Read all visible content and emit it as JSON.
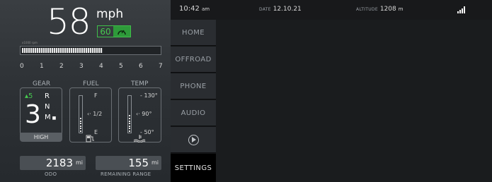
{
  "speed": {
    "value": "58",
    "unit": "mph",
    "limit": "60",
    "cruise_icon": "cruise-control-icon"
  },
  "rpm": {
    "label": "x1000 rpm",
    "ticks": [
      "0",
      "1",
      "2",
      "3",
      "4",
      "5",
      "6",
      "7"
    ],
    "fill_fraction": 0.58
  },
  "gear": {
    "label": "GEAR",
    "current": "3",
    "shift_up": "5",
    "modes": [
      "R",
      "N",
      "M"
    ],
    "mode_label": "HIGH"
  },
  "fuel": {
    "label": "FUEL",
    "full": "F",
    "half": "1/2",
    "empty": "E",
    "level_fraction": 0.4,
    "icon": "fuel-pump-icon"
  },
  "temp": {
    "label": "TEMP",
    "high": "130°",
    "mid": "90°",
    "low": "50°",
    "level_fraction": 0.5,
    "icon": "coolant-temp-icon"
  },
  "odo": {
    "value": "2183",
    "unit": "mi",
    "label": "ODO"
  },
  "range": {
    "value": "155",
    "unit": "mi",
    "label": "REMAINING RANGE"
  },
  "nav": {
    "items": [
      {
        "label": "HOME"
      },
      {
        "label": "OFFROAD"
      },
      {
        "label": "PHONE"
      },
      {
        "label": "AUDIO"
      },
      {
        "label": "",
        "icon": "play-icon"
      },
      {
        "label": "SETTINGS"
      }
    ]
  },
  "status": {
    "time": "10:42",
    "ampm": "am",
    "date_tag": "DATE",
    "date": "12.10.21",
    "alt_tag": "ALTITUDE",
    "altitude": "1208",
    "alt_unit": "m",
    "signal_icon": "signal-strength-icon"
  },
  "colors": {
    "accent_green": "#46c94f",
    "panel": "#2c3034",
    "nav_bg": "#2a2d31"
  }
}
